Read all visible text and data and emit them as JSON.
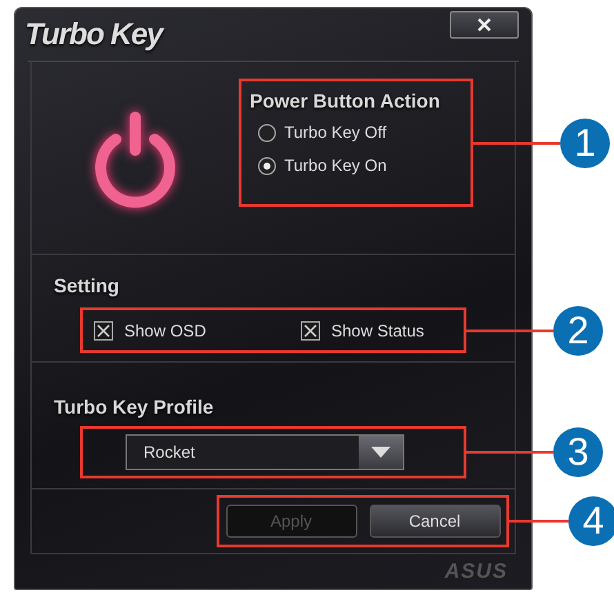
{
  "window": {
    "title": "Turbo Key"
  },
  "power_button_action": {
    "heading": "Power Button Action",
    "callout": "1",
    "options": [
      {
        "label": "Turbo Key Off",
        "selected": false
      },
      {
        "label": "Turbo Key On",
        "selected": true
      }
    ]
  },
  "setting": {
    "heading": "Setting",
    "callout": "2",
    "options": [
      {
        "label": "Show OSD",
        "checked": true
      },
      {
        "label": "Show Status",
        "checked": true
      }
    ]
  },
  "profile": {
    "heading": "Turbo Key Profile",
    "callout": "3",
    "value": "Rocket"
  },
  "actions": {
    "callout": "4",
    "buttons": [
      {
        "label": "Apply",
        "disabled": true
      },
      {
        "label": "Cancel",
        "disabled": false
      }
    ]
  },
  "footer": {
    "logo": "ASUS"
  }
}
